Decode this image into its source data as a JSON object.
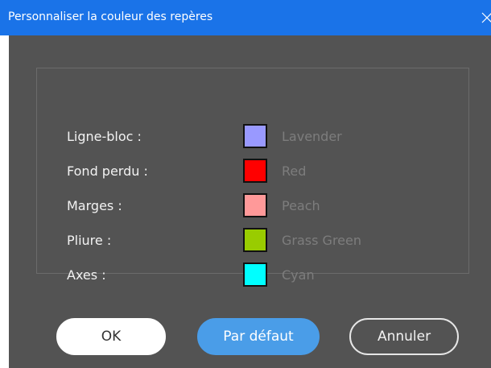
{
  "window": {
    "title": "Personnaliser la couleur des repères"
  },
  "guides": [
    {
      "label": "Ligne-bloc :",
      "color_name": "Lavender",
      "color": "#9999ff"
    },
    {
      "label": "Fond perdu :",
      "color_name": "Red",
      "color": "#ff0000"
    },
    {
      "label": "Marges :",
      "color_name": "Peach",
      "color": "#ff9999"
    },
    {
      "label": "Pliure :",
      "color_name": "Grass Green",
      "color": "#99cc00"
    },
    {
      "label": "Axes :",
      "color_name": "Cyan",
      "color": "#00ffff"
    }
  ],
  "buttons": {
    "ok": "OK",
    "default": "Par défaut",
    "cancel": "Annuler"
  },
  "colors": {
    "titlebar": "#1a73e8",
    "background": "#535353",
    "primary_button": "#4a9de8"
  },
  "icons": {
    "close": "close-icon"
  }
}
